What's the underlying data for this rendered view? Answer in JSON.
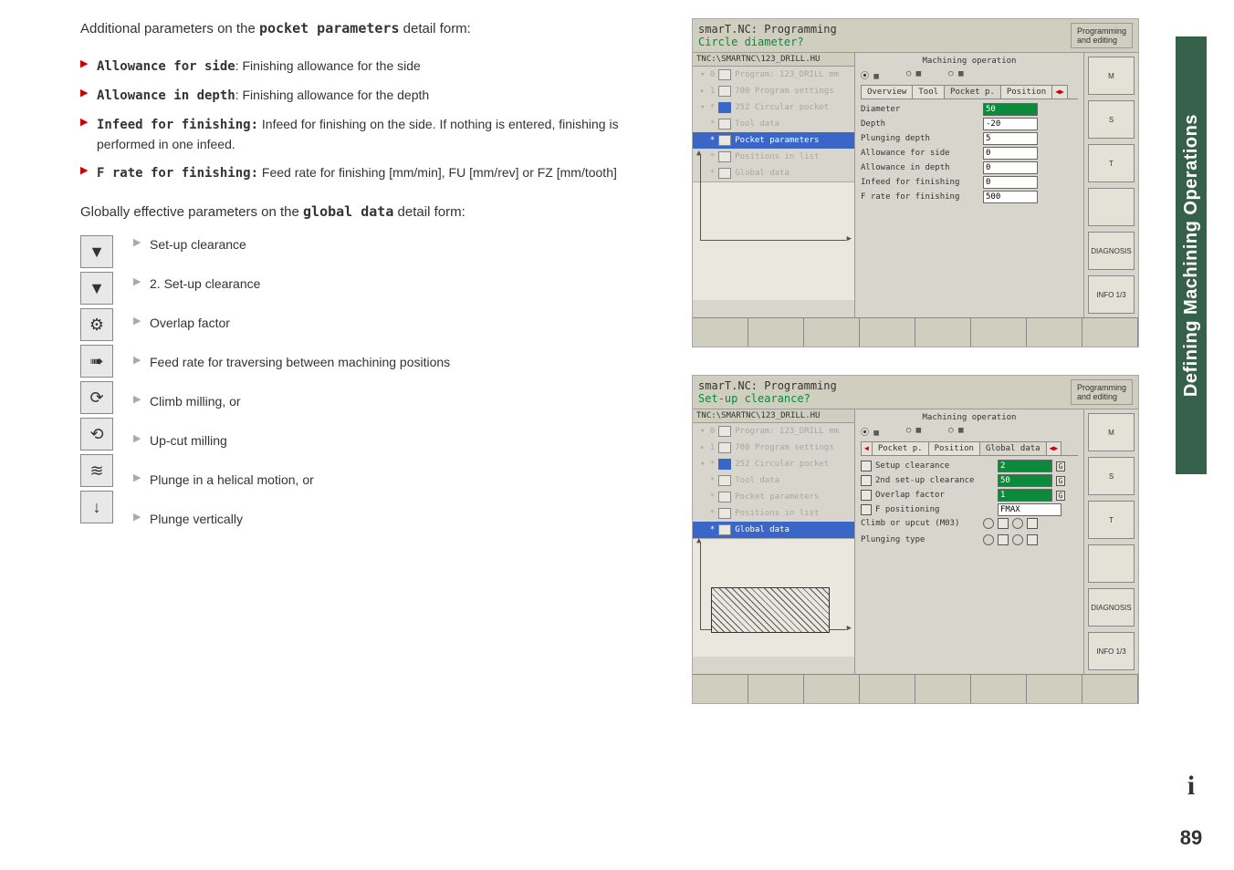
{
  "intro_prefix": "Additional parameters on the ",
  "intro_mono": "pocket parameters",
  "intro_suffix": " detail form:",
  "bullets": [
    {
      "mono": "Allowance for side",
      "rest": ": Finishing allowance for the side"
    },
    {
      "mono": "Allowance in depth",
      "rest": ": Finishing allowance for the depth"
    },
    {
      "mono": "Infeed for finishing:",
      "rest": " Infeed for finishing on the side. If nothing is entered, finishing is performed in one infeed."
    },
    {
      "mono": "F rate for finishing:",
      "rest": " Feed rate for finishing [mm/min], FU [mm/rev] or FZ [mm/tooth]"
    }
  ],
  "global_prefix": "Globally effective parameters on the ",
  "global_mono": "global data",
  "global_suffix": " detail form:",
  "global_items": [
    "Set-up clearance",
    "2. Set-up clearance",
    "Overlap factor",
    "Feed rate for traversing between machining positions",
    "Climb milling, or",
    "Up-cut milling",
    "Plunge in a helical motion, or",
    "Plunge vertically"
  ],
  "global_icons": [
    "▼",
    "▼",
    "⚙",
    "➠",
    "⟳",
    "⟲",
    "≋",
    "↓"
  ],
  "side_tab": "Defining Machining Operations",
  "page_number": "89",
  "ss1": {
    "title1": "smarT.NC: Programming",
    "title2": "Circle diameter?",
    "header_right": "Programming\nand editing",
    "tree_header": "TNC:\\SMARTNC\\123_DRILL.HU",
    "tree": [
      "Program: 123_DRILL mm",
      "700 Program settings",
      "252 Circular pocket",
      "Tool data",
      "Pocket parameters",
      "Positions in list",
      "Global data"
    ],
    "form_header": "Machining operation",
    "tabs": [
      "Overview",
      "Tool",
      "Pocket p.",
      "Position"
    ],
    "rows": [
      {
        "label": "Diameter",
        "value": "50",
        "hl": true
      },
      {
        "label": "Depth",
        "value": "-20",
        "hl": false
      },
      {
        "label": "Plunging depth",
        "value": "5",
        "hl": false
      },
      {
        "label": "Allowance for side",
        "value": "0",
        "hl": false
      },
      {
        "label": "Allowance in depth",
        "value": "0",
        "hl": false
      },
      {
        "label": "Infeed for finishing",
        "value": "0",
        "hl": false
      },
      {
        "label": "F rate for finishing",
        "value": "500",
        "hl": false
      }
    ],
    "side": [
      "M",
      "S",
      "T",
      "",
      "DIAGNOSIS",
      "INFO 1/3"
    ]
  },
  "ss2": {
    "title1": "smarT.NC: Programming",
    "title2": "Set-up clearance?",
    "header_right": "Programming\nand editing",
    "tree_header": "TNC:\\SMARTNC\\123_DRILL.HU",
    "tree": [
      "Program: 123_DRILL mm",
      "700 Program settings",
      "252 Circular pocket",
      "Tool data",
      "Pocket parameters",
      "Positions in list",
      "Global data"
    ],
    "form_header": "Machining operation",
    "tabs": [
      "Pocket p.",
      "Position",
      "Global data"
    ],
    "rows": [
      {
        "label": "Setup clearance",
        "value": "2",
        "hl": true,
        "g": true
      },
      {
        "label": "2nd set-up clearance",
        "value": "50",
        "hl": true,
        "g": true
      },
      {
        "label": "Overlap factor",
        "value": "1",
        "hl": true,
        "g": true
      },
      {
        "label": "F positioning",
        "value": "FMAX",
        "hl": false
      }
    ],
    "climb_label": "Climb or upcut (M03)",
    "plunge_label": "Plunging type",
    "side": [
      "M",
      "S",
      "T",
      "",
      "DIAGNOSIS",
      "INFO 1/3"
    ]
  }
}
